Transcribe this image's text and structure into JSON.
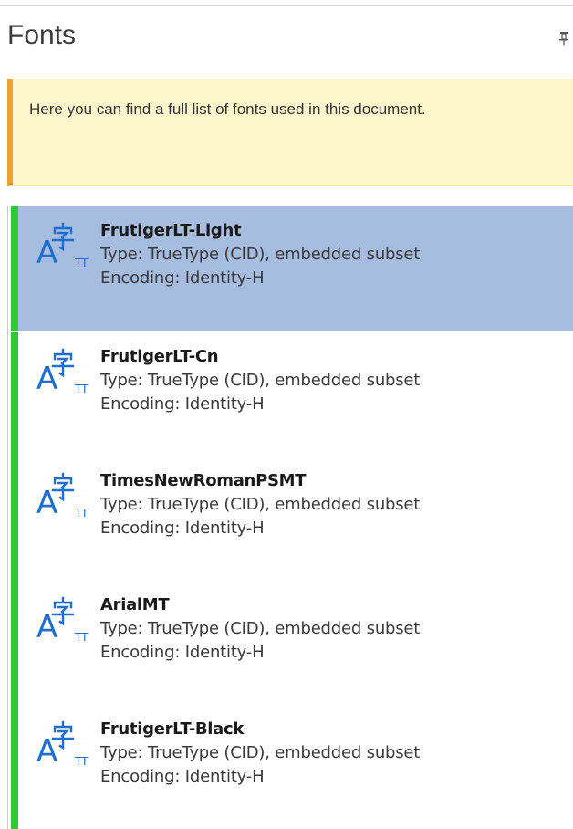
{
  "panel": {
    "title": "Fonts",
    "pin_icon": "pin-icon",
    "info_text": "Here you can find a full list of fonts used in this document."
  },
  "colors": {
    "accent_bar": "#2ec936",
    "selected_bg": "#a7bddf",
    "info_bg": "#fdf6cc",
    "info_border": "#f0a030",
    "icon_blue": "#1f6fd1"
  },
  "fonts": [
    {
      "name": "FrutigerLT-Light",
      "type": "Type: TrueType (CID), embedded subset",
      "encoding": "Encoding: Identity-H",
      "selected": true,
      "icon": "font-icon"
    },
    {
      "name": "FrutigerLT-Cn",
      "type": "Type: TrueType (CID), embedded subset",
      "encoding": "Encoding: Identity-H",
      "selected": false,
      "icon": "font-icon"
    },
    {
      "name": "TimesNewRomanPSMT",
      "type": "Type: TrueType (CID), embedded subset",
      "encoding": "Encoding: Identity-H",
      "selected": false,
      "icon": "font-icon"
    },
    {
      "name": "ArialMT",
      "type": "Type: TrueType (CID), embedded subset",
      "encoding": "Encoding: Identity-H",
      "selected": false,
      "icon": "font-icon"
    },
    {
      "name": "FrutigerLT-Black",
      "type": "Type: TrueType (CID), embedded subset",
      "encoding": "Encoding: Identity-H",
      "selected": false,
      "icon": "font-icon"
    }
  ]
}
